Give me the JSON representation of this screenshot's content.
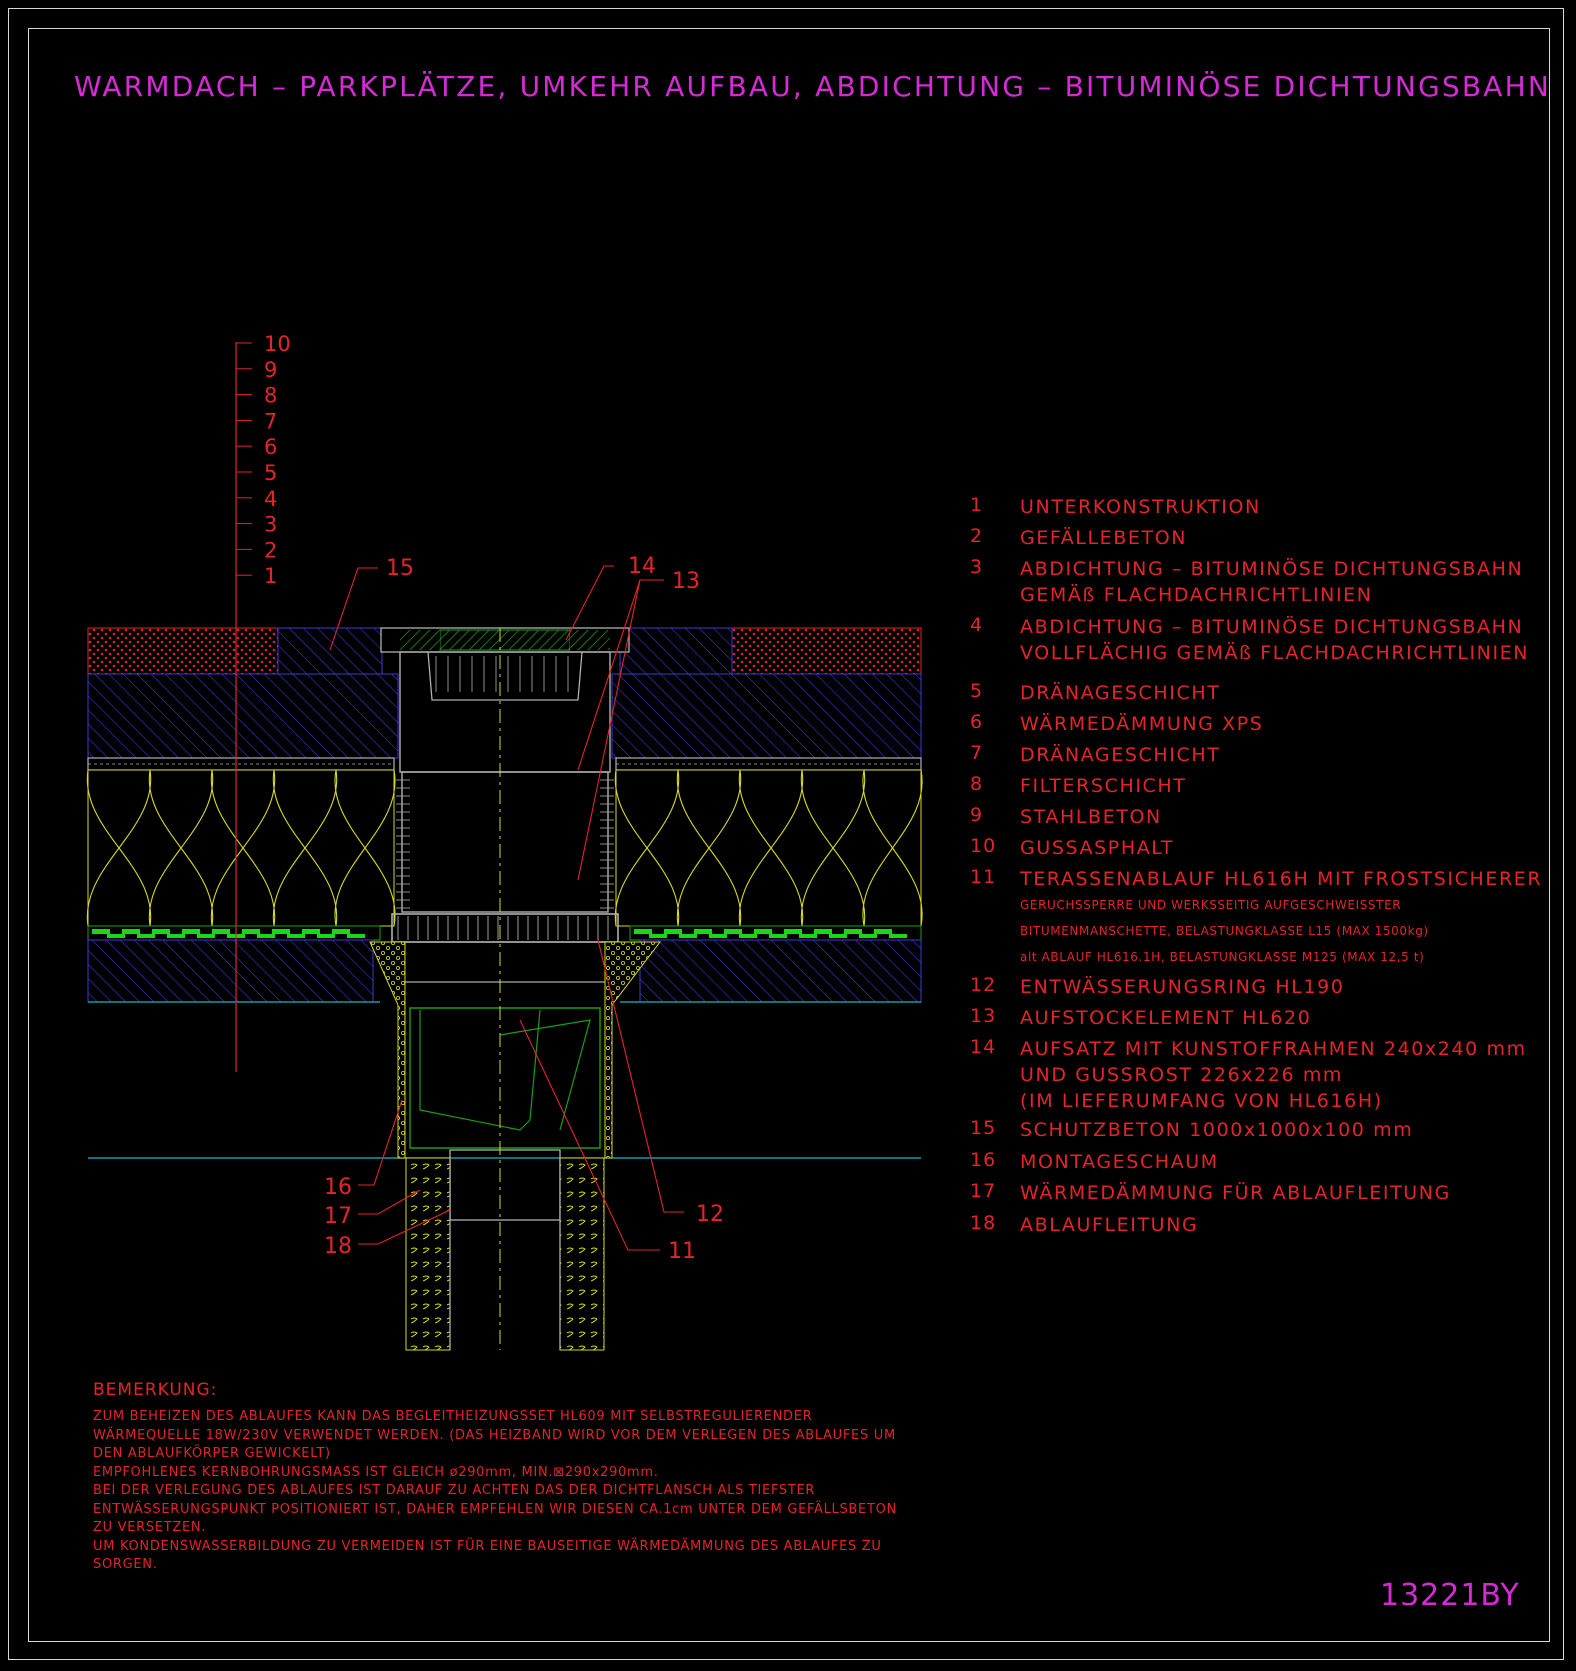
{
  "title": "WARMDACH – PARKPLÄTZE, UMKEHR AUFBAU, ABDICHTUNG – BITUMINÖSE DICHTUNGSBAHN",
  "drawing_code": "13221BY",
  "layer_scale": [
    "10",
    "9",
    "8",
    "7",
    "6",
    "5",
    "4",
    "3",
    "2",
    "1"
  ],
  "legend": [
    {
      "num": "1",
      "lines": [
        "UNTERKONSTRUKTION"
      ]
    },
    {
      "num": "2",
      "lines": [
        "GEFÄLLEBETON"
      ]
    },
    {
      "num": "3",
      "lines": [
        "ABDICHTUNG – BITUMINÖSE DICHTUNGSBAHN",
        "GEMÄß FLACHDACHRICHTLINIEN"
      ]
    },
    {
      "num": "4",
      "lines": [
        "ABDICHTUNG – BITUMINÖSE DICHTUNGSBAHN",
        "VOLLFLÄCHIG GEMÄß FLACHDACHRICHTLINIEN"
      ]
    },
    {
      "num": "5",
      "lines": [
        "DRÄNAGESCHICHT"
      ]
    },
    {
      "num": "6",
      "lines": [
        "WÄRMEDÄMMUNG XPS"
      ]
    },
    {
      "num": "7",
      "lines": [
        "DRÄNAGESCHICHT"
      ]
    },
    {
      "num": "8",
      "lines": [
        "FILTERSCHICHT"
      ]
    },
    {
      "num": "9",
      "lines": [
        "STAHLBETON"
      ]
    },
    {
      "num": "10",
      "lines": [
        "GUSSASPHALT"
      ]
    },
    {
      "num": "11",
      "lines": [
        "TERASSENABLAUF HL616H MIT FROSTSICHERER"
      ],
      "small": [
        "GERUCHSSPERRE UND WERKSSEITIG AUFGESCHWEISSTER",
        "BITUMENMANSCHETTE, BELASTUNGKLASSE L15 (MAX 1500kg)",
        "alt ABLAUF HL616.1H, BELASTUNGKLASSE M125 (MAX 12,5 t)"
      ]
    },
    {
      "num": "12",
      "lines": [
        "ENTWÄSSERUNGSRING HL190"
      ]
    },
    {
      "num": "13",
      "lines": [
        "AUFSTOCKELEMENT HL620"
      ]
    },
    {
      "num": "14",
      "lines": [
        "AUFSATZ MIT KUNSTOFFRAHMEN 240x240 mm",
        "UND GUSSROST 226x226 mm",
        "(IM LIEFERUMFANG VON HL616H)"
      ]
    },
    {
      "num": "15",
      "lines": [
        "SCHUTZBETON 1000x1000x100 mm"
      ]
    },
    {
      "num": "16",
      "lines": [
        "MONTAGESCHAUM"
      ]
    },
    {
      "num": "17",
      "lines": [
        "WÄRMEDÄMMUNG FÜR ABLAUFLEITUNG"
      ]
    },
    {
      "num": "18",
      "lines": [
        "ABLAUFLEITUNG"
      ]
    }
  ],
  "callouts": [
    "15",
    "14",
    "13",
    "16",
    "17",
    "18",
    "12",
    "11"
  ],
  "notes": {
    "title": "BEMERKUNG:",
    "lines": [
      "ZUM BEHEIZEN DES ABLAUFES KANN DAS BEGLEITHEIZUNGSSET HL609 MIT SELBSTREGULIERENDER",
      "WÄRMEQUELLE 18W/230V VERWENDET WERDEN. (DAS HEIZBAND WIRD VOR DEM VERLEGEN DES ABLAUFES UM",
      "DEN ABLAUFKÖRPER GEWICKELT)",
      "EMPFOHLENES KERNBOHRUNGSMASS IST GLEICH ø290mm, MIN.⊠290x290mm.",
      "BEI DER VERLEGUNG DES ABLAUFES IST DARAUF ZU ACHTEN DAS DER DICHTFLANSCH ALS TIEFSTER",
      "ENTWÄSSERUNGSPUNKT POSITIONIERT IST, DAHER EMPFEHLEN WIR DIESEN CA.1cm UNTER DEM GEFÄLLSBETON",
      "ZU VERSETZEN.",
      "UM KONDENSWASSERBILDUNG ZU VERMEIDEN IST FÜR EINE BAUSEITIGE WÄRMEDÄMMUNG DES ABLAUFES ZU",
      "SORGEN."
    ]
  },
  "colors": {
    "title": "#d42bd4",
    "annotation": "#e3242b",
    "frame": "#d8d8d8",
    "hatch": "#3a3ad8",
    "insulation": "#d8d820",
    "membrane": "#18d818",
    "drain": "#b0b0b0",
    "ground": "#18b8c8"
  }
}
